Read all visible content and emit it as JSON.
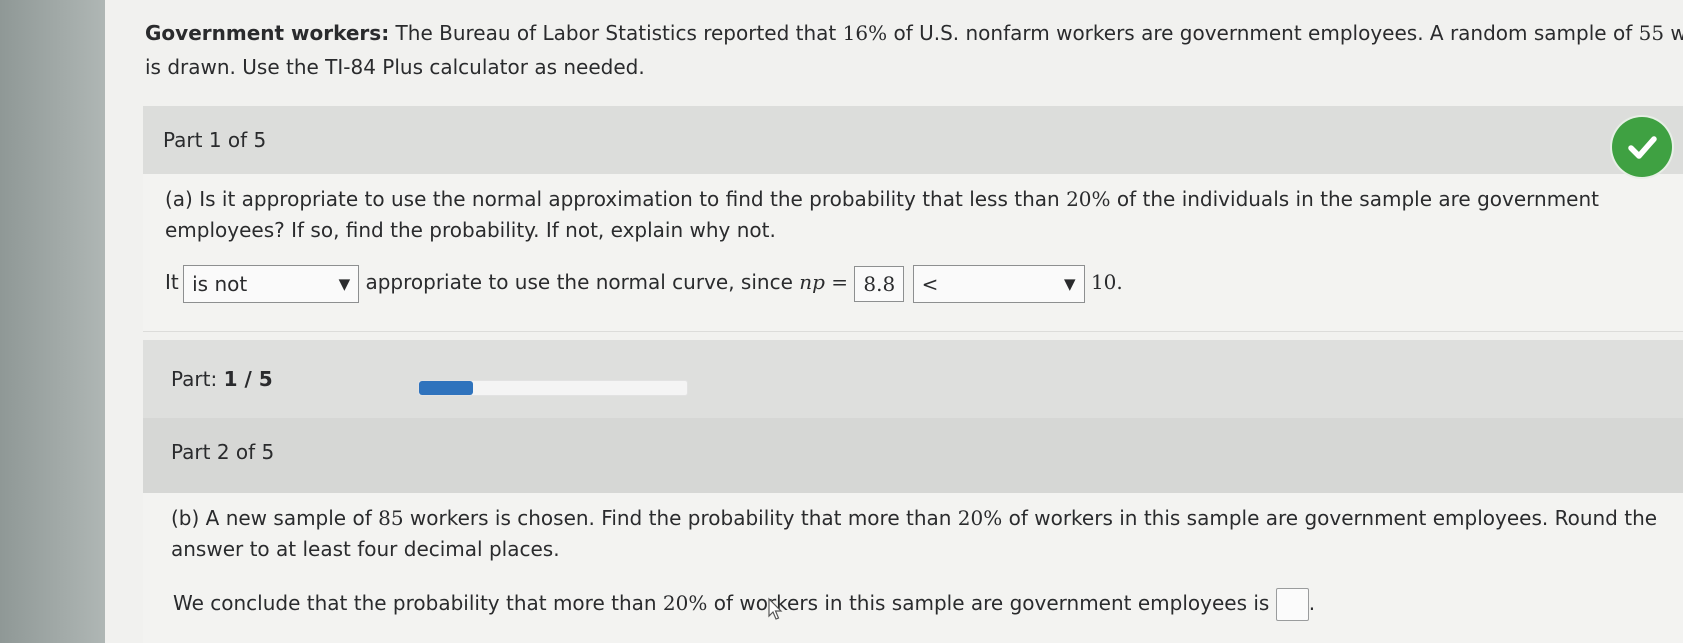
{
  "intro": {
    "label": "Government workers:",
    "text_1": " The Bureau of Labor Statistics reported that ",
    "pct": "16%",
    "text_2": " of U.S. nonfarm workers are government employees. A random sample of ",
    "n": "55",
    "text_3": " worker",
    "line2": "is drawn. Use the TI-84 Plus calculator as needed."
  },
  "part1": {
    "header": "Part 1 of 5",
    "status_icon": "check-icon",
    "status_color": "#3fa142",
    "question_a1": "(a) Is it appropriate to use the normal approximation to find the probability that less than ",
    "question_pct": "20%",
    "question_a2": " of the individuals in the sample are government",
    "question_line2": "employees? If so, find the probability. If not, explain why not.",
    "answer_prefix": "It",
    "is_select_value": "is not",
    "answer_mid": "appropriate to use the normal curve, since",
    "np_label": "np =",
    "np_value": "8.8",
    "compare_select_value": "<",
    "threshold": "10."
  },
  "progress": {
    "label": "Part:",
    "value": "1 / 5",
    "fraction": 0.2,
    "color": "#2f73bd"
  },
  "part2": {
    "header": "Part 2 of 5",
    "question_b1": "(b) A new sample of ",
    "question_n": "85",
    "question_b2": " workers is chosen. Find the probability that more than ",
    "question_pct": "20%",
    "question_b3": " of workers in this sample are government employees. Round the",
    "question_line2": "answer to at least four decimal places.",
    "conclusion_1": "We conclude that the probability that more than ",
    "conclusion_pct": "20%",
    "conclusion_2": " of workers in this sample are government employees is",
    "conclusion_end": "."
  }
}
